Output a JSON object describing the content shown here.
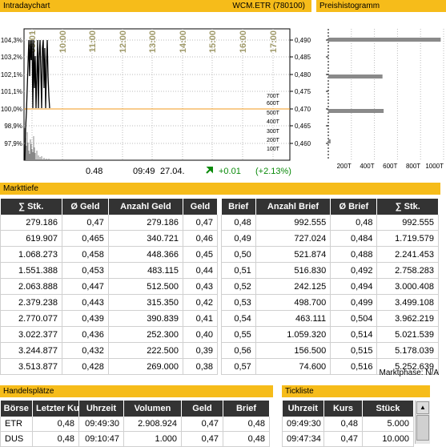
{
  "header": {
    "intraday_title": "Intradaychart",
    "symbol_label": "WCM.ETR (780100)",
    "histogram_title": "Preishistogramm"
  },
  "intraday_chart": {
    "y_left_labels": [
      "104,3%",
      "103,2%",
      "102,1%",
      "101,1%",
      "100,0%",
      "98,9%",
      "97,9%"
    ],
    "y_right_labels": [
      "0,490",
      "0,485",
      "0,480",
      "0,475",
      "0,470",
      "0,465",
      "0,460"
    ],
    "time_labels": [
      "09:01",
      "10:00",
      "11:00",
      "12:00",
      "13:00",
      "14:00",
      "15:00",
      "16:00",
      "17:00"
    ],
    "volume_labels": [
      "700T",
      "600T",
      "500T",
      "400T",
      "300T",
      "200T",
      "100T"
    ],
    "reference_line_color": "#f29a1c"
  },
  "quote": {
    "price": "0.48",
    "time": "09:49",
    "date": "27.04.",
    "change_abs": "+0.01",
    "change_pct": "(+2.13%)",
    "trend_icon": "arrow-up-right-icon",
    "change_color": "#0a8a0a"
  },
  "histogram": {
    "x_labels": [
      "200T",
      "400T",
      "600T",
      "800T",
      "1000T"
    ],
    "bars": [
      {
        "price": "0,490",
        "volume": 975000
      },
      {
        "price": "0,480",
        "volume": 470000
      },
      {
        "price": "0,470",
        "volume": 480000
      },
      {
        "price": "0,460",
        "volume": 20000
      }
    ]
  },
  "markttiefe": {
    "title": "Markttiefe",
    "bid_headers": [
      "∑ Stk.",
      "Ø Geld",
      "Anzahl Geld",
      "Geld"
    ],
    "ask_headers": [
      "Brief",
      "Anzahl Brief",
      "Ø Brief",
      "∑ Stk."
    ],
    "bid_rows": [
      [
        "279.186",
        "0,47",
        "279.186",
        "0,47"
      ],
      [
        "619.907",
        "0,465",
        "340.721",
        "0,46"
      ],
      [
        "1.068.273",
        "0,458",
        "448.366",
        "0,45"
      ],
      [
        "1.551.388",
        "0,453",
        "483.115",
        "0,44"
      ],
      [
        "2.063.888",
        "0,447",
        "512.500",
        "0,43"
      ],
      [
        "2.379.238",
        "0,443",
        "315.350",
        "0,42"
      ],
      [
        "2.770.077",
        "0,439",
        "390.839",
        "0,41"
      ],
      [
        "3.022.377",
        "0,436",
        "252.300",
        "0,40"
      ],
      [
        "3.244.877",
        "0,432",
        "222.500",
        "0,39"
      ],
      [
        "3.513.877",
        "0,428",
        "269.000",
        "0,38"
      ]
    ],
    "ask_rows": [
      [
        "0,48",
        "992.555",
        "0,48",
        "992.555"
      ],
      [
        "0,49",
        "727.024",
        "0,484",
        "1.719.579"
      ],
      [
        "0,50",
        "521.874",
        "0,488",
        "2.241.453"
      ],
      [
        "0,51",
        "516.830",
        "0,492",
        "2.758.283"
      ],
      [
        "0,52",
        "242.125",
        "0,494",
        "3.000.408"
      ],
      [
        "0,53",
        "498.700",
        "0,499",
        "3.499.108"
      ],
      [
        "0,54",
        "463.111",
        "0,504",
        "3.962.219"
      ],
      [
        "0,55",
        "1.059.320",
        "0,514",
        "5.021.539"
      ],
      [
        "0,56",
        "156.500",
        "0,515",
        "5.178.039"
      ],
      [
        "0,57",
        "74.600",
        "0,516",
        "5.252.639"
      ]
    ],
    "phase": "Marktphase: N/A"
  },
  "handelsplaetze": {
    "title": "Handelsplätze",
    "headers": [
      "Börse",
      "Letzter Kurs",
      "Uhrzeit",
      "Volumen",
      "Geld",
      "Brief"
    ],
    "rows": [
      [
        "ETR",
        "0,48",
        "09:49:30",
        "2.908.924",
        "0,47",
        "0,48"
      ],
      [
        "DUS",
        "0,48",
        "09:10:47",
        "1.000",
        "0,47",
        "0,48"
      ]
    ]
  },
  "tickliste": {
    "title": "Tickliste",
    "headers": [
      "Uhrzeit",
      "Kurs",
      "Stück"
    ],
    "rows": [
      [
        "09:49:30",
        "0,48",
        "5.000"
      ],
      [
        "09:47:34",
        "0,47",
        "10.000"
      ]
    ]
  }
}
